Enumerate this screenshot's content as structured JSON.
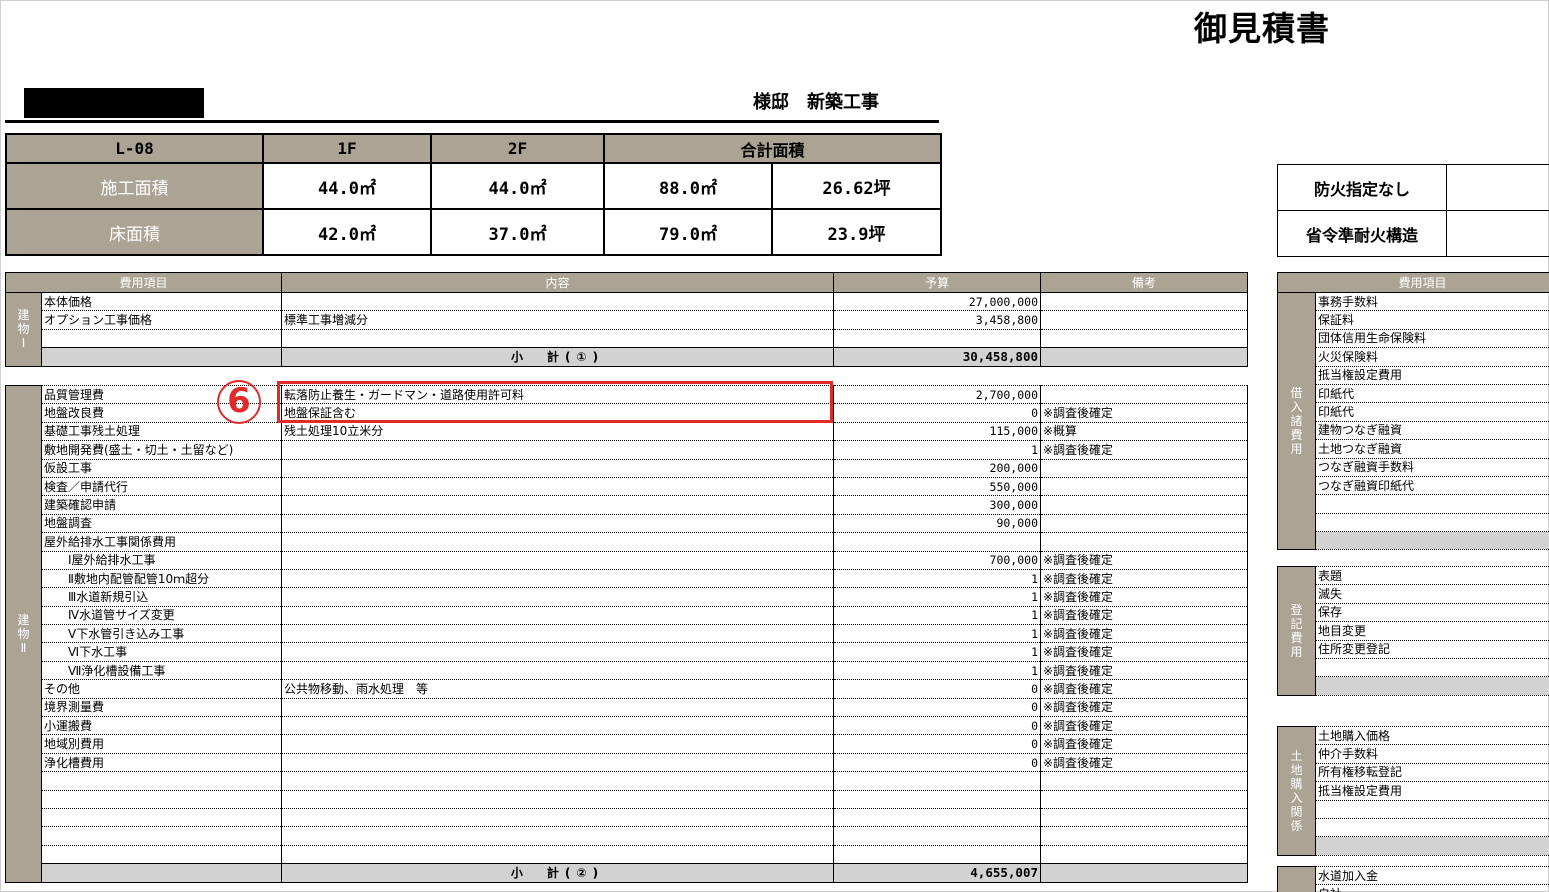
{
  "doc_title": "御見積書",
  "project_title": "様邸　新築工事",
  "area_table": {
    "plan": "L-08",
    "col_1f": "1F",
    "col_2f": "2F",
    "col_total": "合計面積",
    "rows": [
      {
        "label": "施工面積",
        "f1": "44.0㎡",
        "f2": "44.0㎡",
        "total_m2": "88.0㎡",
        "total_tsubo": "26.62坪"
      },
      {
        "label": "床面積",
        "f1": "42.0㎡",
        "f2": "37.0㎡",
        "total_m2": "79.0㎡",
        "total_tsubo": "23.9坪"
      }
    ]
  },
  "fire": {
    "row1": "防火指定なし",
    "row2": "省令準耐火構造"
  },
  "cost_header": {
    "item": "費用項目",
    "content": "内容",
    "budget": "予算",
    "notes": "備考"
  },
  "building1": {
    "side_label": "建物Ⅰ",
    "rows": [
      {
        "item": "本体価格",
        "content": "",
        "budget": "27,000,000",
        "note": ""
      },
      {
        "item": "オプション工事価格",
        "content": "標準工事増減分",
        "budget": "3,458,800",
        "note": ""
      },
      {
        "item": "",
        "content": "",
        "budget": "",
        "note": ""
      }
    ],
    "subtotal_label": "小　計(①)",
    "subtotal": "30,458,800"
  },
  "building2": {
    "side_label": "建物Ⅱ",
    "rows": [
      {
        "item": "品質管理費",
        "content": "転落防止養生・ガードマン・道路使用許可料",
        "budget": "2,700,000",
        "note": ""
      },
      {
        "item": "地盤改良費",
        "content": "地盤保証含む",
        "budget": "0",
        "note": "※調査後確定"
      },
      {
        "item": "基礎工事残土処理",
        "content": "残土処理10立米分",
        "budget": "115,000",
        "note": "※概算"
      },
      {
        "item": "敷地開発費(盛土・切土・土留など)",
        "content": "",
        "budget": "1",
        "note": "※調査後確定"
      },
      {
        "item": "仮設工事",
        "content": "",
        "budget": "200,000",
        "note": ""
      },
      {
        "item": "検査／申請代行",
        "content": "",
        "budget": "550,000",
        "note": ""
      },
      {
        "item": "建築確認申請",
        "content": "",
        "budget": "300,000",
        "note": ""
      },
      {
        "item": "地盤調査",
        "content": "",
        "budget": "90,000",
        "note": ""
      },
      {
        "item": "屋外給排水工事関係費用",
        "content": "",
        "budget": "",
        "note": ""
      },
      {
        "item": "Ⅰ屋外給排水工事",
        "content": "",
        "budget": "700,000",
        "note": "※調査後確定",
        "indent": true
      },
      {
        "item": "Ⅱ敷地内配管配管10ｍ超分",
        "content": "",
        "budget": "1",
        "note": "※調査後確定",
        "indent": true
      },
      {
        "item": "Ⅲ水道新規引込",
        "content": "",
        "budget": "1",
        "note": "※調査後確定",
        "indent": true
      },
      {
        "item": "Ⅳ水道管サイズ変更",
        "content": "",
        "budget": "1",
        "note": "※調査後確定",
        "indent": true
      },
      {
        "item": "Ⅴ下水管引き込み工事",
        "content": "",
        "budget": "1",
        "note": "※調査後確定",
        "indent": true
      },
      {
        "item": "Ⅵ下水工事",
        "content": "",
        "budget": "1",
        "note": "※調査後確定",
        "indent": true
      },
      {
        "item": "Ⅶ浄化槽設備工事",
        "content": "",
        "budget": "1",
        "note": "※調査後確定",
        "indent": true
      },
      {
        "item": "その他",
        "content": "公共物移動、雨水処理　等",
        "budget": "0",
        "note": "※調査後確定"
      },
      {
        "item": "境界測量費",
        "content": "",
        "budget": "0",
        "note": "※調査後確定"
      },
      {
        "item": "小運搬費",
        "content": "",
        "budget": "0",
        "note": "※調査後確定"
      },
      {
        "item": "地域別費用",
        "content": "",
        "budget": "0",
        "note": "※調査後確定"
      },
      {
        "item": "浄化槽費用",
        "content": "",
        "budget": "0",
        "note": "※調査後確定"
      },
      {
        "item": "",
        "content": "",
        "budget": "",
        "note": ""
      },
      {
        "item": "",
        "content": "",
        "budget": "",
        "note": ""
      },
      {
        "item": "",
        "content": "",
        "budget": "",
        "note": ""
      },
      {
        "item": "",
        "content": "",
        "budget": "",
        "note": ""
      },
      {
        "item": "",
        "content": "",
        "budget": "",
        "note": ""
      }
    ],
    "subtotal_label": "小　計(②)",
    "subtotal": "4,655,007"
  },
  "right_header": "費用項目",
  "loan": {
    "side_label": "借入諸費用",
    "items": [
      "事務手数料",
      "保証料",
      "団体信用生命保険料",
      "火災保険料",
      "抵当権設定費用",
      "印紙代",
      "印紙代",
      "建物つなぎ融資",
      "土地つなぎ融資",
      "つなぎ融資手数料",
      "つなぎ融資印紙代",
      "",
      "",
      ""
    ]
  },
  "registration": {
    "side_label": "登記費用",
    "items": [
      "表題",
      "滅失",
      "保存",
      "地目変更",
      "住所変更登記",
      "",
      ""
    ]
  },
  "land": {
    "side_label": "土地購入関係",
    "items": [
      "土地購入価格",
      "仲介手数料",
      "所有権移転登記",
      "抵当権設定費用",
      "",
      "",
      ""
    ]
  },
  "water": {
    "items": [
      "水道加入金",
      "自社"
    ]
  },
  "annotation": {
    "number": "6",
    "color": "#e02b2b"
  },
  "colors": {
    "header_bg": "#aba393",
    "subtotal_bg": "#d2d2d2",
    "highlight": "#e02b2b"
  }
}
